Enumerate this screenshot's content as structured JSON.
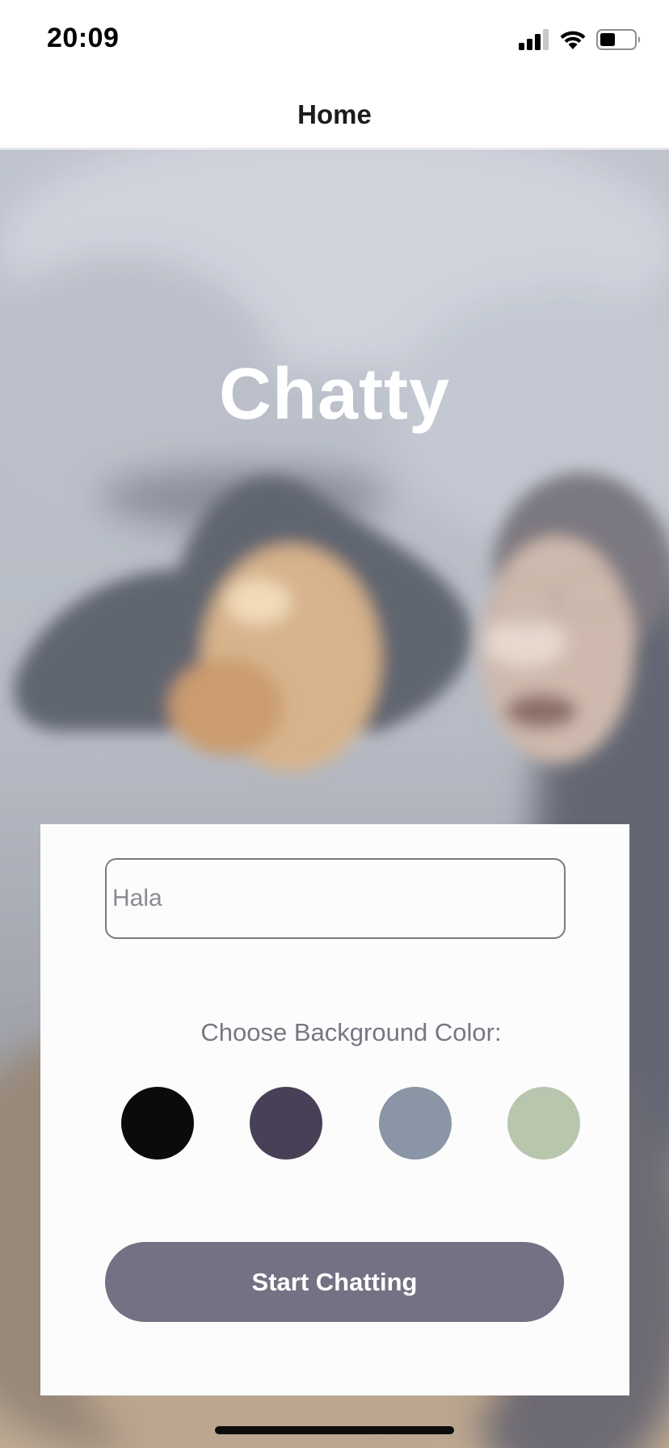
{
  "status_bar": {
    "time": "20:09",
    "icons": [
      "cellular-signal-icon",
      "wifi-icon",
      "battery-icon"
    ]
  },
  "nav": {
    "title": "Home"
  },
  "hero": {
    "app_title": "Chatty"
  },
  "form": {
    "name_input": {
      "placeholder": "Hala",
      "value": ""
    },
    "color_label": "Choose Background Color:",
    "colors": [
      "#090C08",
      "#474056",
      "#8A95A5",
      "#B9C6AE"
    ],
    "start_button_label": "Start Chatting",
    "start_button_color": "#757083"
  }
}
